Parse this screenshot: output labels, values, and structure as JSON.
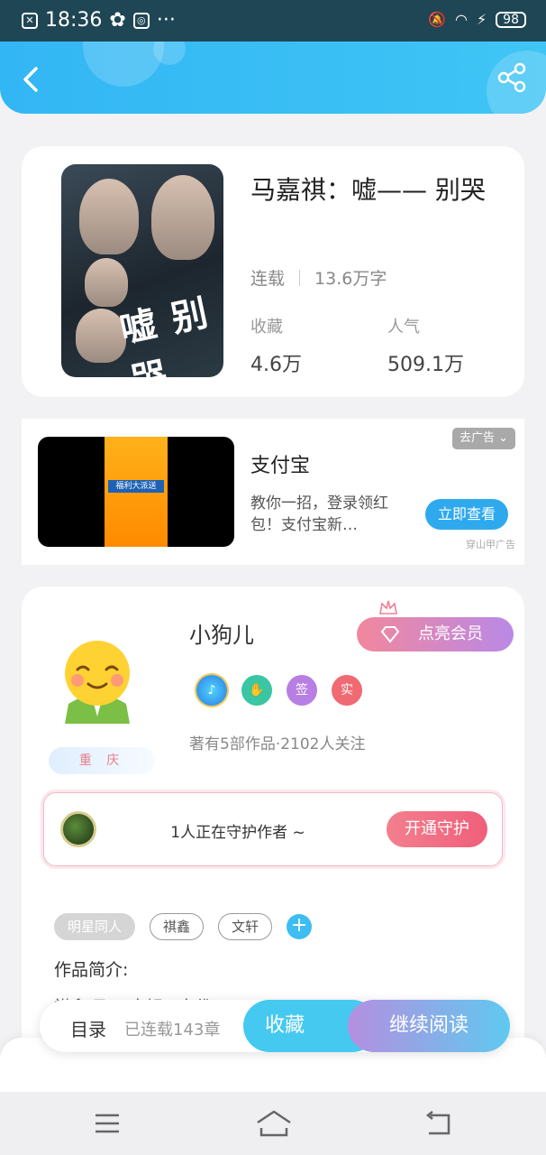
{
  "status_bar": {
    "time": "18:36",
    "dots": "···",
    "battery": "98"
  },
  "book": {
    "title": "马嘉祺：嘘—— 别哭",
    "status": "连载",
    "word_count": "13.6万字",
    "favorites_label": "收藏",
    "favorites_value": "4.6万",
    "popularity_label": "人气",
    "popularity_value": "509.1万",
    "cover_title": "嘘 别哭"
  },
  "ad": {
    "remove_label": "去广告",
    "title": "支付宝",
    "description": "教你一招，登录领红包！支付宝新…",
    "cta": "立即查看",
    "source": "穿山甲广告",
    "poster_text": "福利大派送"
  },
  "author": {
    "name": "小狗儿",
    "location": "重 庆",
    "vip_button": "点亮会员",
    "badges": [
      "签",
      "实"
    ],
    "stats": "著有5部作品·2102人关注",
    "guard_text": "1人正在守护作者 ~",
    "guard_button": "开通守护",
    "tags": [
      "明星同人",
      "祺鑫",
      "文轩"
    ],
    "intro_label": "作品简介:",
    "intro_text": "祺鑫/马丁/文轩下文代"
  },
  "bottom_bar": {
    "toc": "目录",
    "chapters": "已连载143章",
    "collect": "收藏",
    "continue": "继续阅读"
  },
  "colors": {
    "header": "#33b6f4",
    "accent_blue": "#2fa9ee",
    "guard_pink": "#f05f7a"
  }
}
